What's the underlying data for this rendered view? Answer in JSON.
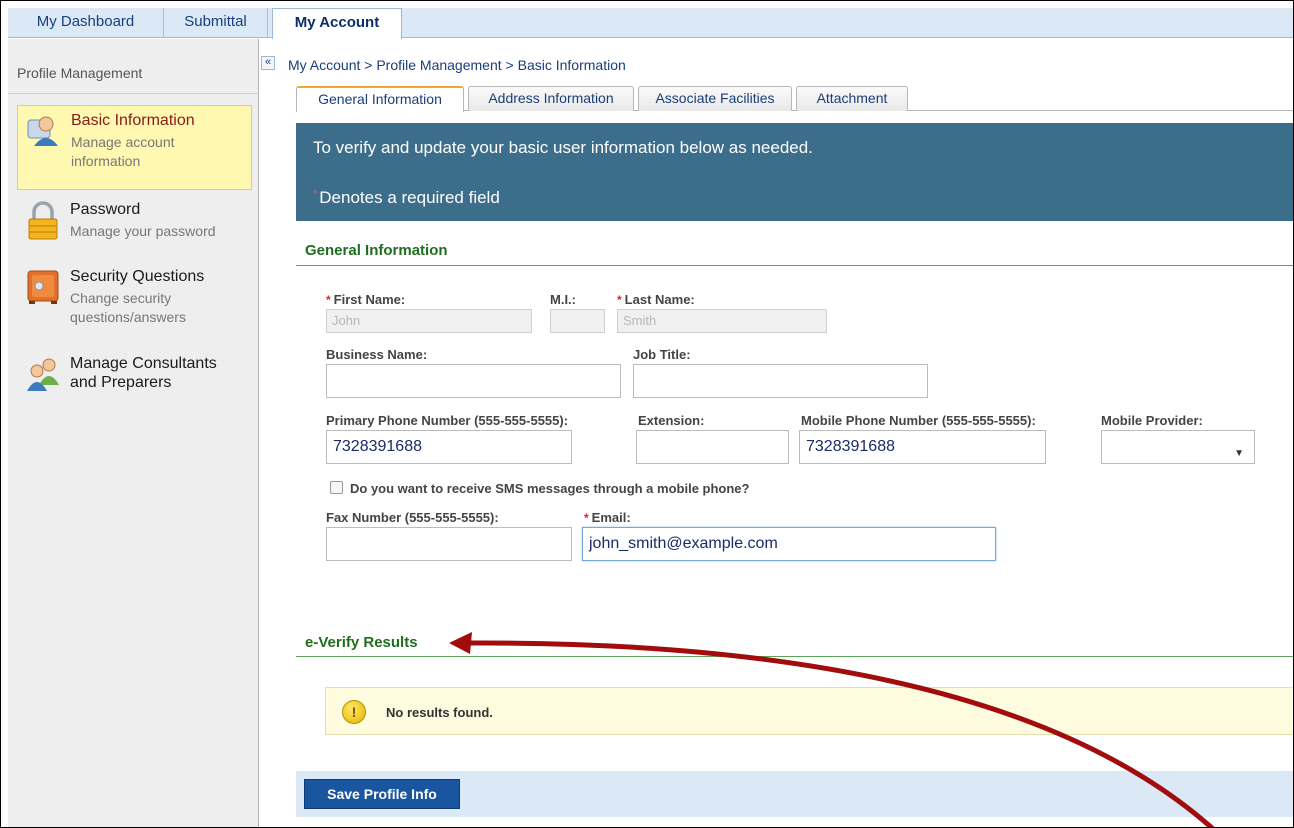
{
  "topnav": {
    "tabs": [
      "My Dashboard",
      "Submittal",
      "My Account"
    ]
  },
  "sidebar": {
    "header": "Profile Management",
    "items": [
      {
        "label": "Basic Information",
        "desc1": "Manage account",
        "desc2": "information",
        "icon": "user-card-icon"
      },
      {
        "label": "Password",
        "desc1": "Manage your password",
        "icon": "padlock-icon"
      },
      {
        "label": "Security Questions",
        "desc1": "Change security",
        "desc2": "questions/answers",
        "icon": "safe-icon"
      },
      {
        "label": "Manage Consultants",
        "label2": "and Preparers",
        "icon": "people-icon"
      }
    ],
    "collapse": "«"
  },
  "breadcrumb": {
    "a": "My Account",
    "sep": " > ",
    "b": "Profile Management",
    "c": "Basic Information"
  },
  "subtabs": [
    "General Information",
    "Address Information",
    "Associate Facilities",
    "Attachment"
  ],
  "banner": {
    "line1": "To verify and update your basic user information below as needed.",
    "line2": "Denotes a required field",
    "star": "*"
  },
  "general": {
    "title": "General Information",
    "first_name_label": "First Name:",
    "first_name": "John",
    "mi_label": "M.I.:",
    "mi": "",
    "last_name_label": "Last Name:",
    "last_name": "Smith",
    "business_label": "Business Name:",
    "business": "",
    "job_label": "Job Title:",
    "job": "",
    "phone_label": "Primary Phone Number (555-555-5555):",
    "phone": "7328391688",
    "ext_label": "Extension:",
    "ext": "",
    "mobile_label": "Mobile Phone Number (555-555-5555):",
    "mobile": "7328391688",
    "provider_label": "Mobile Provider:",
    "provider": "",
    "sms_label": "Do you want to receive SMS messages through a mobile phone?",
    "fax_label": "Fax Number (555-555-5555):",
    "fax": "",
    "email_label": "Email:",
    "email": "john_smith@example.com",
    "req": "*"
  },
  "everify": {
    "title": "e-Verify Results",
    "noresults": "No results found.",
    "warn": "!"
  },
  "save_label": "Save Profile Info",
  "colors": {
    "banner": "#3c6e8c",
    "section_title": "#1f6e1f",
    "annotation_arrow": "#a10d0d",
    "save_button": "#1a55a0"
  }
}
